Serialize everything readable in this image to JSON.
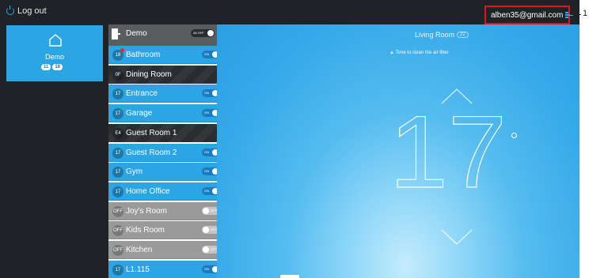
{
  "topbar": {
    "logout_label": "Log out",
    "account_email": "alben35@gmail.com",
    "callout": "1"
  },
  "sidebar": {
    "home_label": "Demo",
    "badges": [
      "11",
      "18"
    ]
  },
  "rooms": [
    {
      "name": "Demo",
      "temp": "",
      "state": "demo",
      "toggle": "All OFF"
    },
    {
      "name": "Bathroom",
      "temp": "18",
      "state": "on",
      "toggle": "ON"
    },
    {
      "name": "Dining Room",
      "temp": "0F",
      "state": "dark",
      "toggle": ""
    },
    {
      "name": "Entrance",
      "temp": "17",
      "state": "on",
      "toggle": "ON"
    },
    {
      "name": "Garage",
      "temp": "17",
      "state": "on",
      "toggle": "ON"
    },
    {
      "name": "Guest Room 1",
      "temp": "E4",
      "state": "dark",
      "toggle": ""
    },
    {
      "name": "Guest Room 2",
      "temp": "17",
      "state": "on",
      "toggle": "ON"
    },
    {
      "name": "Gym",
      "temp": "17",
      "state": "on",
      "toggle": "ON"
    },
    {
      "name": "Home Office",
      "temp": "17",
      "state": "on",
      "toggle": "ON"
    },
    {
      "name": "Joy's Room",
      "temp": "OFF",
      "state": "off",
      "toggle": "OFF"
    },
    {
      "name": "Kids Room",
      "temp": "OFF",
      "state": "off",
      "toggle": "OFF"
    },
    {
      "name": "Kitchen",
      "temp": "OFF",
      "state": "off",
      "toggle": "OFF"
    },
    {
      "name": "L1.115",
      "temp": "17",
      "state": "on",
      "toggle": "ON"
    }
  ],
  "main": {
    "room_title": "Living Room",
    "room_temp": "22",
    "notice": "▲ Time to clean the air filter",
    "setpoint": "17"
  },
  "colors": {
    "accent": "#2ba5e4",
    "topbar": "#1f2226",
    "alert": "#e2141b"
  },
  "icons": [
    "power-icon",
    "menu-icon",
    "home-icon",
    "door-icon",
    "chevron-up-icon",
    "chevron-down-icon"
  ]
}
